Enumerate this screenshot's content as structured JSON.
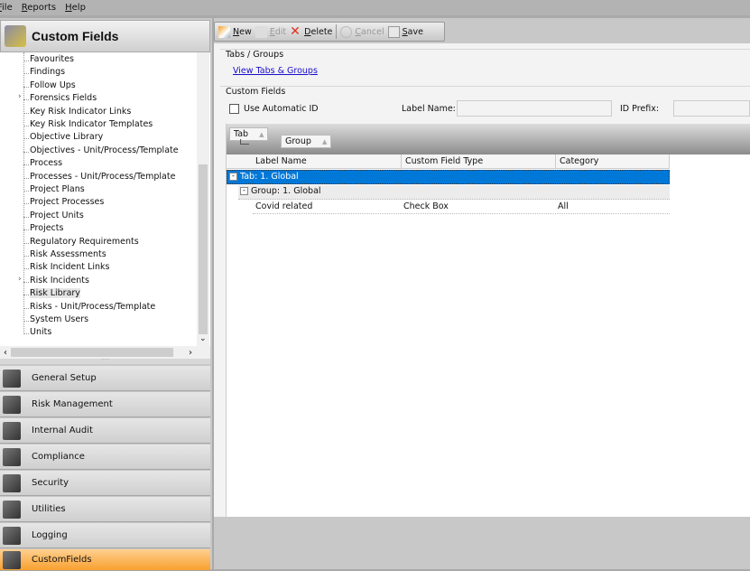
{
  "menu": [
    "File",
    "Reports",
    "Help"
  ],
  "left_header": {
    "title": "Custom Fields"
  },
  "tree": {
    "items": [
      {
        "label": "Favourites"
      },
      {
        "label": "Findings"
      },
      {
        "label": "Follow Ups"
      },
      {
        "label": "Forensics Fields",
        "expandable": true
      },
      {
        "label": "Key Risk Indicator Links"
      },
      {
        "label": "Key Risk Indicator Templates"
      },
      {
        "label": "Objective Library"
      },
      {
        "label": "Objectives - Unit/Process/Template"
      },
      {
        "label": "Process"
      },
      {
        "label": "Processes - Unit/Process/Template"
      },
      {
        "label": "Project Plans"
      },
      {
        "label": "Project Processes"
      },
      {
        "label": "Project Units"
      },
      {
        "label": "Projects"
      },
      {
        "label": "Regulatory Requirements"
      },
      {
        "label": "Risk Assessments"
      },
      {
        "label": "Risk Incident Links"
      },
      {
        "label": "Risk Incidents",
        "expandable": true
      },
      {
        "label": "Risk Library",
        "selected": true
      },
      {
        "label": "Risks - Unit/Process/Template"
      },
      {
        "label": "System Users"
      },
      {
        "label": "Units"
      }
    ]
  },
  "nav": [
    {
      "label": "General Setup",
      "icon": "folder-icon"
    },
    {
      "label": "Risk Management",
      "icon": "risk-icon"
    },
    {
      "label": "Internal Audit",
      "icon": "briefcase-icon"
    },
    {
      "label": "Compliance",
      "icon": "checklist-icon"
    },
    {
      "label": "Security",
      "icon": "security-folder-icon"
    },
    {
      "label": "Utilities",
      "icon": "utilities-icon"
    },
    {
      "label": "Logging",
      "icon": "clock-icon"
    },
    {
      "label": "CustomFields",
      "icon": "custom-fields-icon",
      "active": true
    }
  ],
  "toolbar": {
    "new": "New",
    "edit": "Edit",
    "delete": "Delete",
    "cancel": "Cancel",
    "save": "Save"
  },
  "tabs_groups": {
    "title": "Tabs / Groups",
    "link": "View Tabs & Groups"
  },
  "custom_fields": {
    "title": "Custom Fields",
    "use_auto_id": "Use Automatic ID",
    "use_auto_id_checked": false,
    "label_name_label": "Label Name:",
    "label_name_value": "",
    "id_prefix_label": "ID Prefix:",
    "id_prefix_value": ""
  },
  "grid": {
    "group_by": [
      "Tab",
      "Group"
    ],
    "columns": [
      "Label Name",
      "Custom Field Type",
      "Category"
    ],
    "tab_row": "Tab: 1. Global",
    "group_row": "Group: 1. Global",
    "rows": [
      {
        "label": "Covid related",
        "type": "Check Box",
        "category": "All"
      }
    ]
  },
  "colors": {
    "accent": "#0078d7",
    "active_nav": "#f8a030",
    "link": "#1a0dcc"
  }
}
